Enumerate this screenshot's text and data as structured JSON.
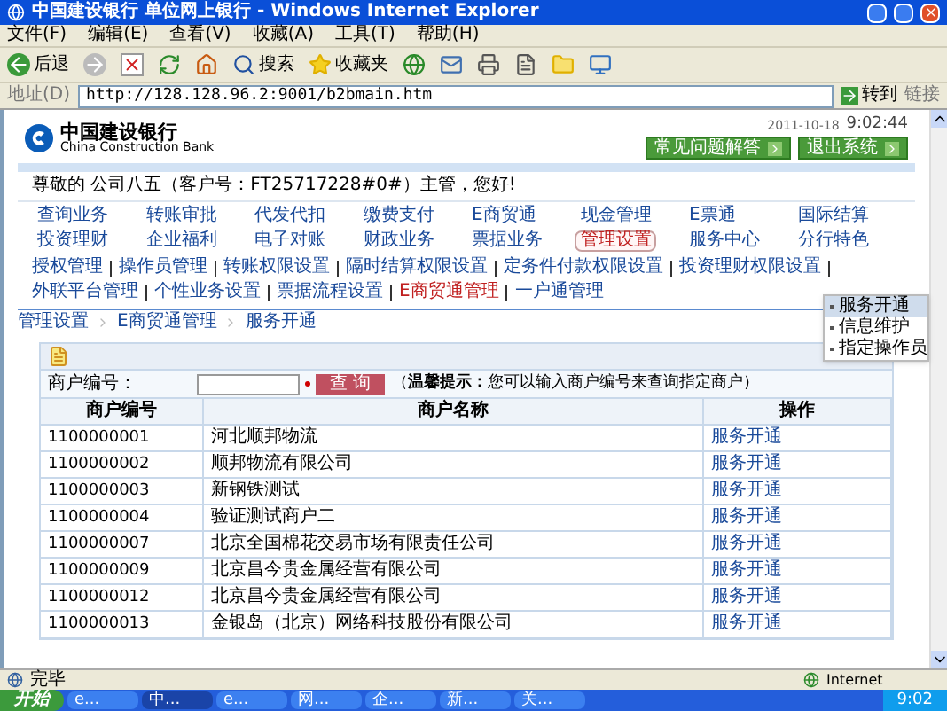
{
  "window": {
    "title": "中国建设银行 单位网上银行 - Windows Internet Explorer"
  },
  "menu": [
    "文件(F)",
    "编辑(E)",
    "查看(V)",
    "收藏(A)",
    "工具(T)",
    "帮助(H)"
  ],
  "toolbar": {
    "back": "后退",
    "search": "搜索",
    "favorites": "收藏夹"
  },
  "address": {
    "label": "地址(D)",
    "url": "http://128.128.96.2:9001/b2bmain.htm",
    "go": "转到",
    "links": "链接"
  },
  "header": {
    "logo_cn": "中国建设银行",
    "logo_en": "China Construction Bank",
    "date": "2011-10-18",
    "time": "9:02:44",
    "buttons": [
      "常见问题解答",
      "退出系统"
    ]
  },
  "greeting": "尊敬的 公司八五（客户号：FT25717228#0#）主管，您好!",
  "nav": [
    {
      "label": "查询业务",
      "selected": false
    },
    {
      "label": "转账审批",
      "selected": false
    },
    {
      "label": "代发代扣",
      "selected": false
    },
    {
      "label": "缴费支付",
      "selected": false
    },
    {
      "label": "E商贸通",
      "selected": false
    },
    {
      "label": "现金管理",
      "selected": false
    },
    {
      "label": "E票通",
      "selected": false
    },
    {
      "label": "国际结算",
      "selected": false
    },
    {
      "label": "投资理财",
      "selected": false
    },
    {
      "label": "企业福利",
      "selected": false
    },
    {
      "label": "电子对账",
      "selected": false
    },
    {
      "label": "财政业务",
      "selected": false
    },
    {
      "label": "票据业务",
      "selected": false
    },
    {
      "label": "管理设置",
      "selected": true
    },
    {
      "label": "服务中心",
      "selected": false
    },
    {
      "label": "分行特色",
      "selected": false
    }
  ],
  "subnav": [
    {
      "label": "授权管理",
      "selected": false
    },
    {
      "label": "操作员管理",
      "selected": false
    },
    {
      "label": "转账权限设置",
      "selected": false
    },
    {
      "label": "隔时结算权限设置",
      "selected": false
    },
    {
      "label": "定务件付款权限设置",
      "selected": false
    },
    {
      "label": "投资理财权限设置",
      "selected": false
    },
    {
      "label": "外联平台管理",
      "selected": false
    },
    {
      "label": "个性业务设置",
      "selected": false
    },
    {
      "label": "票据流程设置",
      "selected": false
    },
    {
      "label": "E商贸通管理",
      "selected": true
    },
    {
      "label": "一户通管理",
      "selected": false
    }
  ],
  "breadcrumb": [
    "管理设置",
    "E商贸通管理",
    "服务开通"
  ],
  "side_menu": [
    {
      "label": "服务开通",
      "selected": true
    },
    {
      "label": "信息维护",
      "selected": false
    },
    {
      "label": "指定操作员",
      "selected": false
    }
  ],
  "search": {
    "label": "商户编号：",
    "button": "查 询",
    "hint": "（**温馨提示：**您可以输入商户编号来查询指定商户）"
  },
  "table": {
    "columns": [
      "商户编号",
      "商户名称",
      "操作"
    ],
    "rows": [
      [
        "1100000001",
        "河北顺邦物流",
        "服务开通"
      ],
      [
        "1100000002",
        "顺邦物流有限公司",
        "服务开通"
      ],
      [
        "1100000003",
        "新钢铁测试",
        "服务开通"
      ],
      [
        "1100000004",
        "验证测试商户二",
        "服务开通"
      ],
      [
        "1100000007",
        "北京全国棉花交易市场有限责任公司",
        "服务开通"
      ],
      [
        "1100000009",
        "北京昌今贵金属经营有限公司",
        "服务开通"
      ],
      [
        "1100000012",
        "北京昌今贵金属经营有限公司",
        "服务开通"
      ],
      [
        "1100000013",
        "金银岛（北京）网络科技股份有限公司",
        "服务开通"
      ]
    ]
  },
  "status_bar": {
    "text": "完毕",
    "zone": "Internet"
  },
  "taskbar": {
    "start": "开始",
    "tasks": [
      {
        "label": "e...",
        "selected": false
      },
      {
        "label": "中...",
        "selected": true
      },
      {
        "label": "e...",
        "selected": false
      },
      {
        "label": "网...",
        "selected": false
      },
      {
        "label": "企...",
        "selected": false
      },
      {
        "label": "新...",
        "selected": false
      },
      {
        "label": "关...",
        "selected": false
      }
    ],
    "clock": "9:02"
  }
}
